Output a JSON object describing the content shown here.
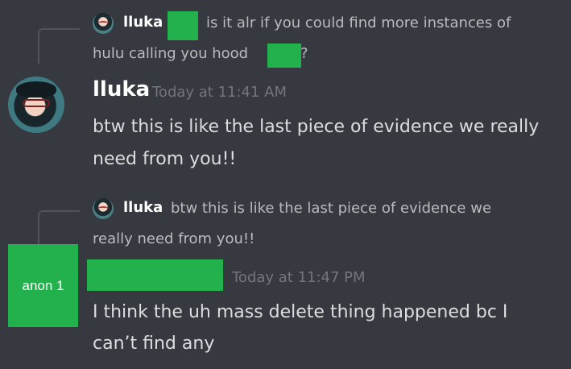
{
  "message1": {
    "reply": {
      "author": "lluka",
      "text_part1": "is it alr if you could find more instances of",
      "text_line2": "hulu calling you hood",
      "text_end": "?"
    },
    "author": "lluka",
    "timestamp": "Today at 11:41 AM",
    "lines": [
      "btw this is like the last piece of evidence we really",
      "need from you!!"
    ]
  },
  "message2": {
    "reply": {
      "author": "lluka",
      "text_line1": "btw this is like the last piece of evidence we",
      "text_line2": "really need from you!!"
    },
    "avatar_label": "anon 1",
    "timestamp": "Today at 11:47 PM",
    "lines": [
      "I think the uh mass delete thing happened bc I",
      "can’t find any"
    ]
  },
  "colors": {
    "background": "#36393f",
    "censor": "#22b14c",
    "username": "#ffffff",
    "timestamp": "#72767d",
    "message_text": "#dcddde",
    "reply_text": "#b9bbbe"
  },
  "icons": {
    "reply_avatar": "user-avatar-icon",
    "main_avatar": "user-avatar-icon"
  }
}
